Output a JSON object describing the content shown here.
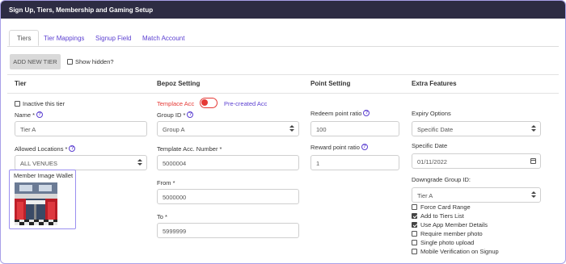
{
  "window": {
    "title": "Sign Up, Tiers, Membership and Gaming Setup"
  },
  "tabs": [
    {
      "label": "Tiers",
      "active": true
    },
    {
      "label": "Tier Mappings",
      "active": false
    },
    {
      "label": "Signup Field",
      "active": false
    },
    {
      "label": "Match Account",
      "active": false
    }
  ],
  "toolbar": {
    "add_label": "ADD NEW TIER",
    "show_hidden_label": "Show hidden?",
    "show_hidden_checked": false
  },
  "columns": {
    "tier": "Tier",
    "bepoz": "Bepoz Setting",
    "point": "Point Setting",
    "extra": "Extra Features"
  },
  "tier": {
    "inactive_label": "Inactive this tier",
    "inactive_checked": false,
    "name_label": "Name *",
    "name_value": "Tier A",
    "locations_label": "Allowed Locations *",
    "locations_value": "ALL VENUES",
    "wallet_label": "Member Image Wallet"
  },
  "bepoz": {
    "template_label": "Templace Acc",
    "precreated_label": "Pre-created Acc",
    "group_label": "Group ID *",
    "group_value": "Group A",
    "template_number_label": "Template Acc. Number *",
    "template_number_value": "5000004",
    "from_label": "From *",
    "from_value": "5000000",
    "to_label": "To *",
    "to_value": "5999999"
  },
  "points": {
    "redeem_label": "Redeem point ratio",
    "redeem_value": "100",
    "reward_label": "Reward point ratio",
    "reward_value": "1"
  },
  "extra": {
    "expiry_label": "Expiry Options",
    "expiry_value": "Specific Date",
    "date_label": "Specific Date",
    "date_value": "01/11/2022",
    "downgrade_label": "Downgrade Group ID:",
    "downgrade_value": "Tier A",
    "features": [
      {
        "label": "Force Card Range",
        "checked": false
      },
      {
        "label": "Add to Tiers List",
        "checked": true
      },
      {
        "label": "Use App Member Details",
        "checked": true
      },
      {
        "label": "Require member photo",
        "checked": false
      },
      {
        "label": "Single photo upload",
        "checked": false
      },
      {
        "label": "Mobile Verification on Signup",
        "checked": false
      }
    ]
  },
  "colors": {
    "accent": "#5b3fd1",
    "titlebar": "#2d2c43",
    "toggle": "#e53935",
    "highlight": "#9b8ff0"
  }
}
